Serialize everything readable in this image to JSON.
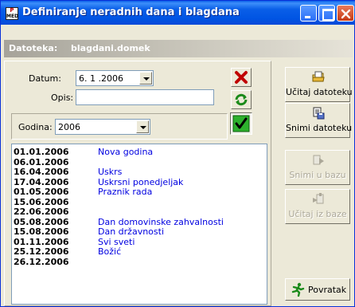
{
  "window": {
    "title": "Definiranje neradnih dana i blagdana",
    "app_icon_text_top": "P",
    "app_icon_text_bottom": "MED"
  },
  "file": {
    "label": "Datoteka:",
    "value": "blagdani.domek"
  },
  "form": {
    "date_label": "Datum:",
    "date_value": "6. 1 .2006",
    "description_label": "Opis:",
    "description_value": "",
    "year_label": "Godina:",
    "year_value": "2006"
  },
  "holidays": [
    {
      "date": "01.01.2006",
      "name": "Nova godina"
    },
    {
      "date": "06.01.2006",
      "name": ""
    },
    {
      "date": "16.04.2006",
      "name": "Uskrs"
    },
    {
      "date": "17.04.2006",
      "name": "Uskrsni ponedjeljak"
    },
    {
      "date": "01.05.2006",
      "name": "Praznik rada"
    },
    {
      "date": "15.06.2006",
      "name": ""
    },
    {
      "date": "22.06.2006",
      "name": ""
    },
    {
      "date": "05.08.2006",
      "name": "Dan domovinske zahvalnosti"
    },
    {
      "date": "15.08.2006",
      "name": "Dan državnosti"
    },
    {
      "date": "01.11.2006",
      "name": "Svi sveti"
    },
    {
      "date": "25.12.2006",
      "name": "Božić"
    },
    {
      "date": "26.12.2006",
      "name": ""
    }
  ],
  "side_buttons": {
    "load_file": "Učitaj datoteku",
    "save_file": "Snimi datoteku",
    "save_db": "Snimi u bazu",
    "load_db": "Učitaj iz baze",
    "back": "Povratak"
  },
  "colors": {
    "titlebar": "#0054e3",
    "holiday_name": "#0000e0",
    "delete_icon": "#c00000",
    "refresh_icon": "#1a8a1a",
    "confirm_icon": "#2db12d"
  }
}
